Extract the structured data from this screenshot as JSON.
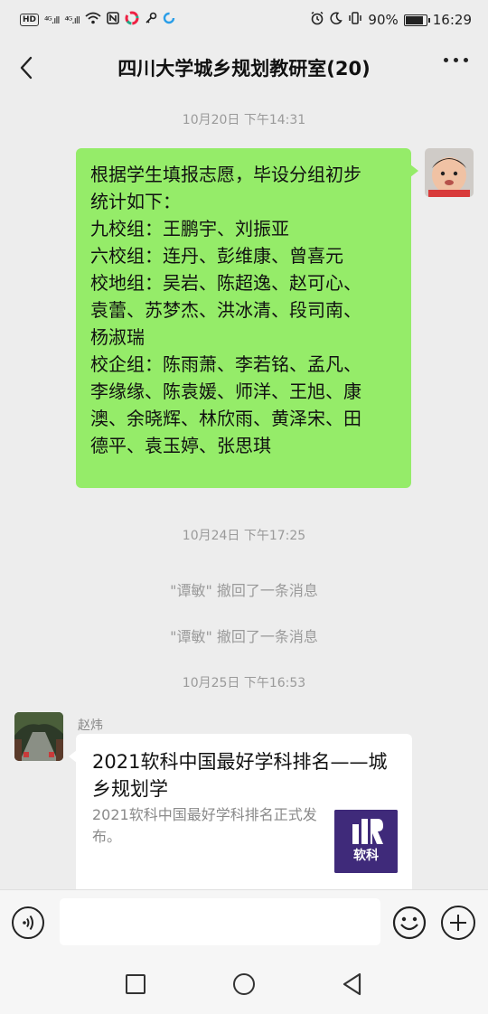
{
  "status_bar": {
    "hd": "HD",
    "signal1": "⁴ᴳ.ıll",
    "signal2": "⁴ᴳ.ıll",
    "battery_text": "90%",
    "battery_level": 0.9,
    "time": "16:29"
  },
  "header": {
    "title": "四川大学城乡规划教研室(20)"
  },
  "messages": {
    "ts1": "10月20日 下午14:31",
    "bubble_lines": [
      "根据学生填报志愿，毕设分组初步",
      "统计如下：",
      "九校组：王鹏宇、刘振亚",
      "六校组：连丹、彭维康、曾喜元",
      "校地组：吴岩、陈超逸、赵可心、",
      "袁蕾、苏梦杰、洪冰清、段司南、",
      "杨淑瑞",
      "校企组：陈雨萧、李若铭、孟凡、",
      "李缘缘、陈袁媛、师洋、王旭、康",
      "澳、余晓辉、林欣雨、黄泽宋、田",
      "德平、袁玉婷、张思琪"
    ],
    "ts2": "10月24日 下午17:25",
    "recall1": "\"谭敏\" 撤回了一条消息",
    "recall2": "\"谭敏\" 撤回了一条消息",
    "ts3": "10月25日 下午16:53",
    "sender": "赵炜",
    "card_title": "2021软科中国最好学科排名——城乡规划学",
    "card_desc": "2021软科中国最好学科排名正式发布。",
    "card_thumb_text": "软科"
  },
  "input": {
    "placeholder": ""
  },
  "colors": {
    "chat_bg": "#ededed",
    "bubble_green": "#95ec69",
    "card_thumb": "#3f2a7a"
  }
}
